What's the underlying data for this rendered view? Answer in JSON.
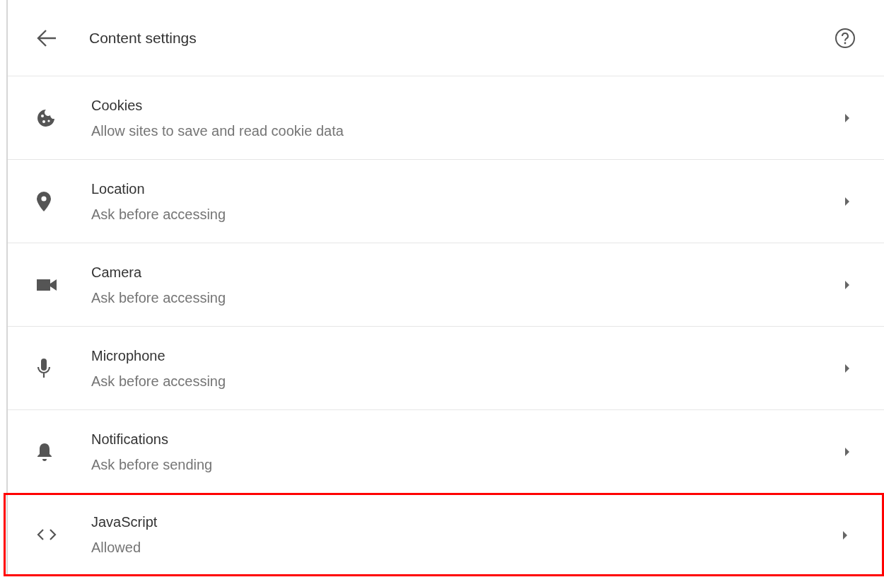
{
  "header": {
    "title": "Content settings"
  },
  "items": [
    {
      "kind": "cookie",
      "title": "Cookies",
      "subtitle": "Allow sites to save and read cookie data",
      "highlighted": false
    },
    {
      "kind": "location",
      "title": "Location",
      "subtitle": "Ask before accessing",
      "highlighted": false
    },
    {
      "kind": "camera",
      "title": "Camera",
      "subtitle": "Ask before accessing",
      "highlighted": false
    },
    {
      "kind": "microphone",
      "title": "Microphone",
      "subtitle": "Ask before accessing",
      "highlighted": false
    },
    {
      "kind": "notifications",
      "title": "Notifications",
      "subtitle": "Ask before sending",
      "highlighted": false
    },
    {
      "kind": "code",
      "title": "JavaScript",
      "subtitle": "Allowed",
      "highlighted": true
    }
  ]
}
